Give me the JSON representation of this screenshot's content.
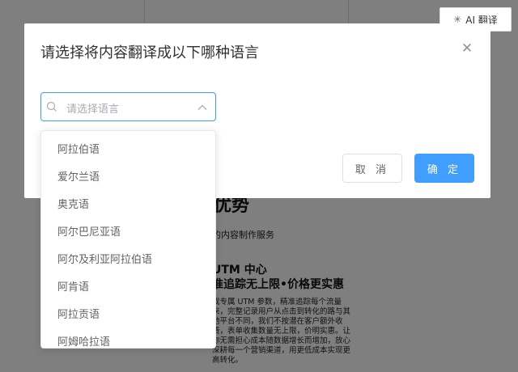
{
  "background": {
    "title": "优势",
    "subtitle": "的内容制作服务",
    "section_title": "UTM 中心",
    "section_subtitle": "准追踪无上限•价格更实惠",
    "paragraph": "我专属 UTM 参数，精准追踪每个流量来，完整记录用户从点击到转化的路与其他平台不同，我们不按潜在客户额外收费，表单收集数量无上限，价明实惠。让你无需担心成本随数据增长而增加，放心深耕每一个营销渠道，用更低成本实现更高转化。"
  },
  "ai_button": {
    "label": "AI 翻译",
    "icon": "sparkle-icon"
  },
  "dialog": {
    "title": "请选择将内容翻译成以下哪种语言",
    "select_placeholder": "请选择语言",
    "cancel_label": "取 消",
    "confirm_label": "确 定"
  },
  "dropdown": {
    "options": [
      "阿拉伯语",
      "爱尔兰语",
      "奥克语",
      "阿尔巴尼亚语",
      "阿尔及利亚阿拉伯语",
      "阿肯语",
      "阿拉贡语",
      "阿姆哈拉语"
    ]
  },
  "colors": {
    "primary": "#409eff",
    "overlay": "rgba(0,0,0,0.5)"
  }
}
